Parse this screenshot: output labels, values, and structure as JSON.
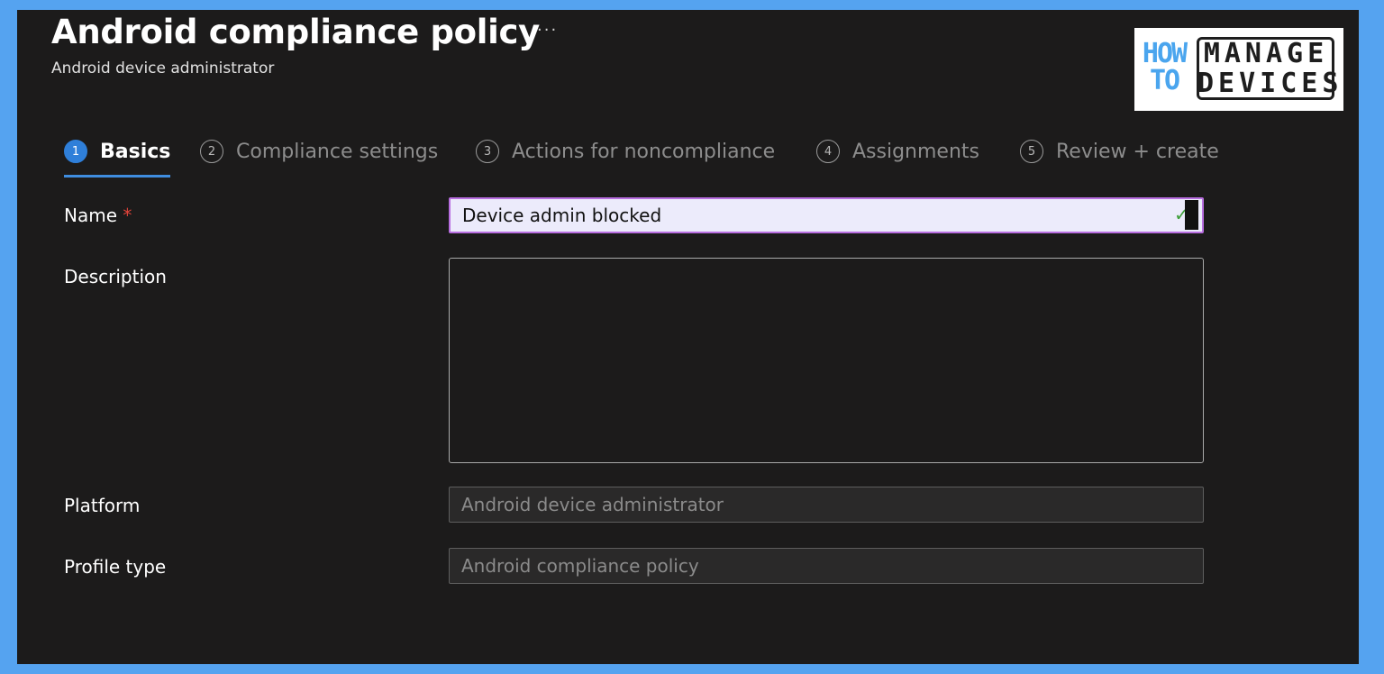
{
  "header": {
    "title": "Android compliance policy",
    "more_label": "···",
    "subtitle": "Android device administrator"
  },
  "logo": {
    "how": "HOW",
    "to": "TO",
    "manage": "MANAGE",
    "devices": "DEVICES",
    "colors": {
      "how_to": "#4aa5ee",
      "manage_devices": "#1e1e1e"
    }
  },
  "steps": [
    {
      "num": "1",
      "label": "Basics",
      "active": true
    },
    {
      "num": "2",
      "label": "Compliance settings",
      "active": false
    },
    {
      "num": "3",
      "label": "Actions for noncompliance",
      "active": false
    },
    {
      "num": "4",
      "label": "Assignments",
      "active": false
    },
    {
      "num": "5",
      "label": "Review + create",
      "active": false
    }
  ],
  "form": {
    "name_label": "Name",
    "required_mark": "*",
    "name_value": "Device admin blocked",
    "description_label": "Description",
    "description_value": "",
    "platform_label": "Platform",
    "platform_value": "Android device administrator",
    "profile_type_label": "Profile type",
    "profile_type_value": "Android compliance policy"
  },
  "colors": {
    "background": "#55a3f0",
    "panel": "#1c1b1b",
    "accent": "#2f7fd9",
    "required": "#e0433a",
    "valid": "#3f9f3a"
  }
}
